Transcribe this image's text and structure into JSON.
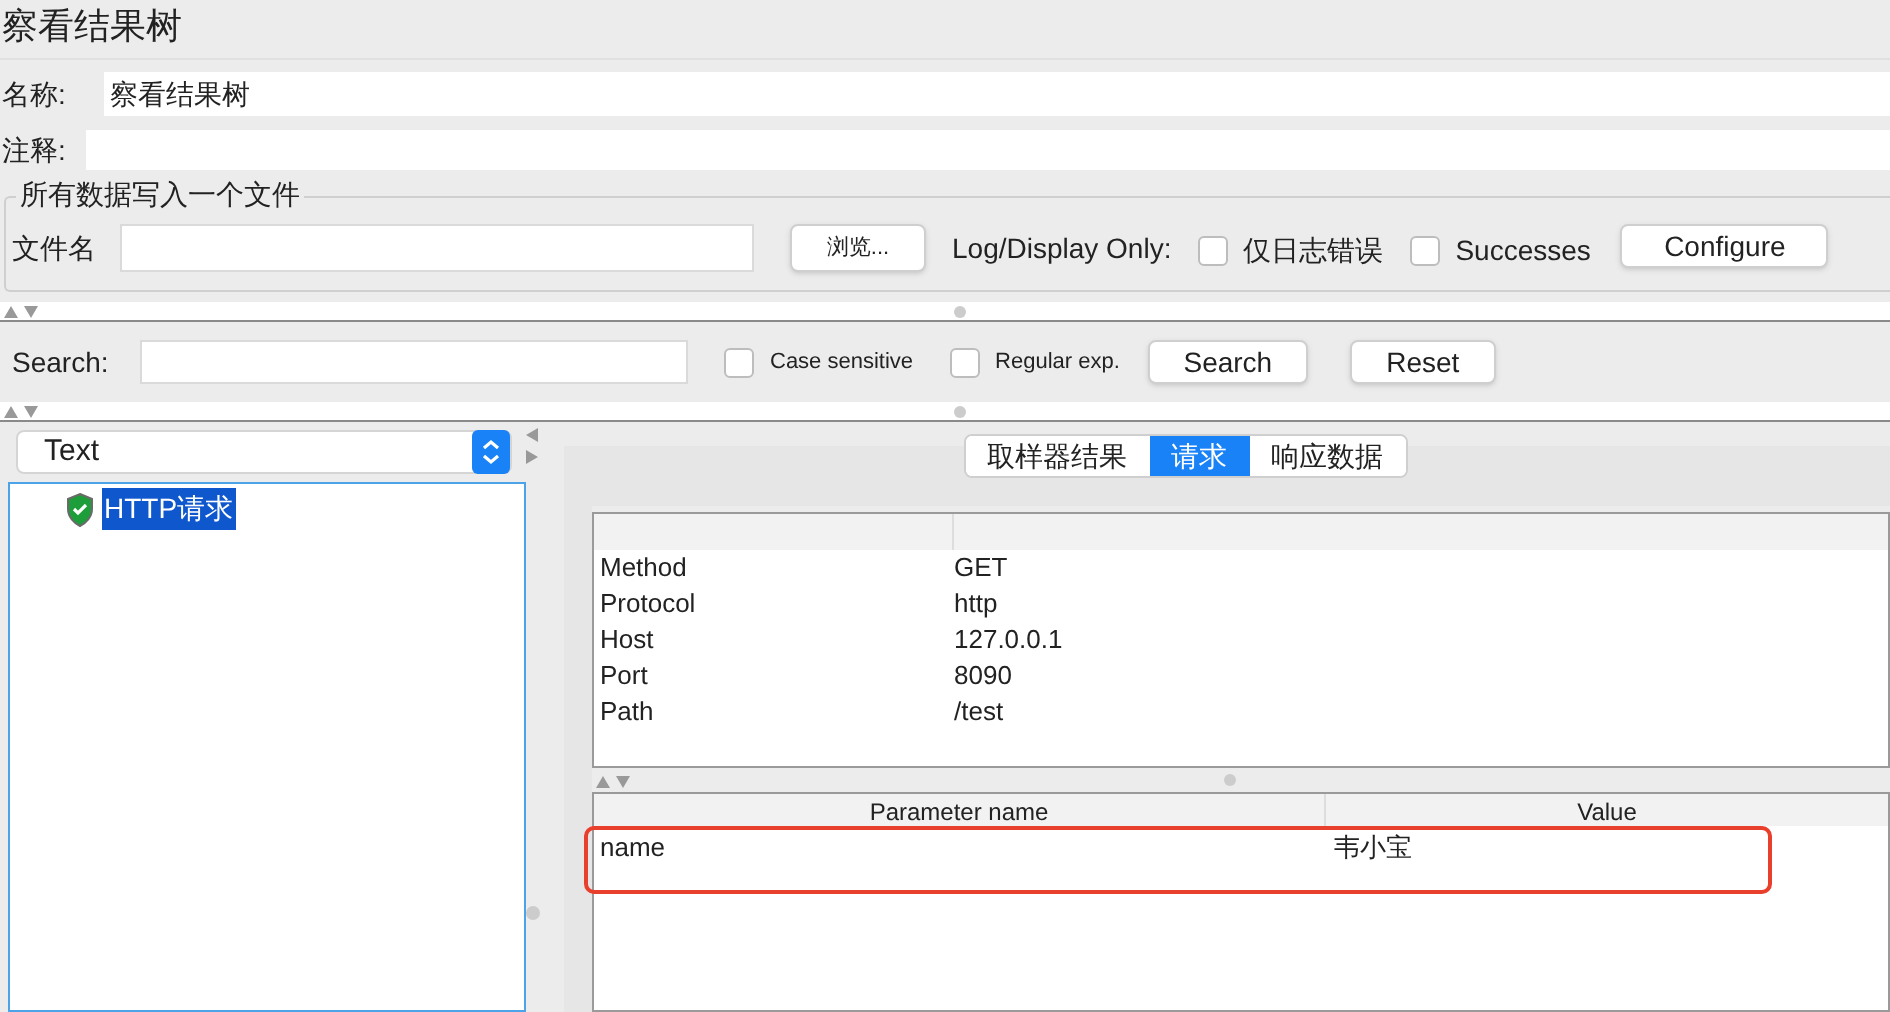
{
  "title": "察看结果树",
  "name_field": {
    "label": "名称:",
    "value": "察看结果树"
  },
  "comment_field": {
    "label": "注释:"
  },
  "file_group": {
    "legend": "所有数据写入一个文件",
    "file_label": "文件名",
    "browse_button": "浏览...",
    "log_label": "Log/Display Only:",
    "checkboxes": [
      {
        "label": "仅日志错误",
        "checked": false
      },
      {
        "label": "Successes",
        "checked": false
      }
    ],
    "configure_button": "Configure"
  },
  "search": {
    "label": "Search:",
    "options": [
      {
        "label": "Case sensitive",
        "checked": false
      },
      {
        "label": "Regular exp.",
        "checked": false
      }
    ],
    "buttons": [
      "Search",
      "Reset"
    ]
  },
  "renderer_select": {
    "value": "Text"
  },
  "tree": [
    {
      "label": "HTTP请求",
      "selected": true
    }
  ],
  "tabs": [
    {
      "label": "取样器结果",
      "selected": false
    },
    {
      "label": "请求",
      "selected": true
    },
    {
      "label": "响应数据",
      "selected": false
    }
  ],
  "request_table": [
    {
      "key": "Method",
      "value": "GET"
    },
    {
      "key": "Protocol",
      "value": "http"
    },
    {
      "key": "Host",
      "value": "127.0.0.1"
    },
    {
      "key": "Port",
      "value": "8090"
    },
    {
      "key": "Path",
      "value": "/test"
    }
  ],
  "params_table": {
    "columns": [
      "Parameter name",
      "Value"
    ],
    "rows": [
      [
        "name",
        "韦小宝"
      ]
    ]
  }
}
